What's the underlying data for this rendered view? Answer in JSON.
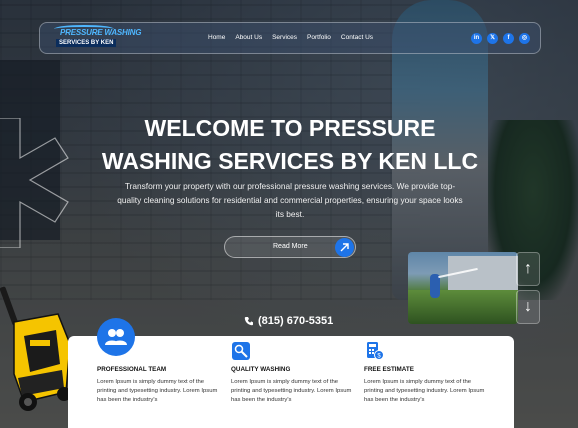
{
  "logo": {
    "line1": "PRESSURE WASHING",
    "line2": "SERVICES BY KEN"
  },
  "nav": {
    "items": [
      "Home",
      "About Us",
      "Services",
      "Portfolio",
      "Contact Us"
    ]
  },
  "socials": {
    "linkedin_label": "in",
    "x_label": "𝕏",
    "facebook_label": "f",
    "instagram_label": "◎"
  },
  "hero": {
    "title_line1": "WELCOME TO PRESSURE",
    "title_line2": "WASHING SERVICES BY KEN LLC",
    "description": "Transform your property with our professional pressure washing services. We provide top-quality cleaning solutions for residential and commercial properties, ensuring your space looks its best.",
    "cta_label": "Read More"
  },
  "contact": {
    "phone": "(815) 670-5351"
  },
  "slider": {
    "up_label": "↑",
    "down_label": "↓"
  },
  "features": [
    {
      "title": "PROFESSIONAL TEAM",
      "text": "Lorem Ipsum is simply dummy text of the printing and typesetting industry. Lorem Ipsum has been the industry's"
    },
    {
      "title": "QUALITY WASHING",
      "text": "Lorem Ipsum is simply dummy text of the printing and typesetting industry. Lorem Ipsum has been the industry's"
    },
    {
      "title": "FREE ESTIMATE",
      "text": "Lorem Ipsum is simply dummy text of the printing and typesetting industry. Lorem Ipsum has been the industry's"
    }
  ],
  "colors": {
    "accent": "#1e74e8",
    "logo_blue": "#4fb7ff",
    "washer_yellow": "#f5c400"
  }
}
